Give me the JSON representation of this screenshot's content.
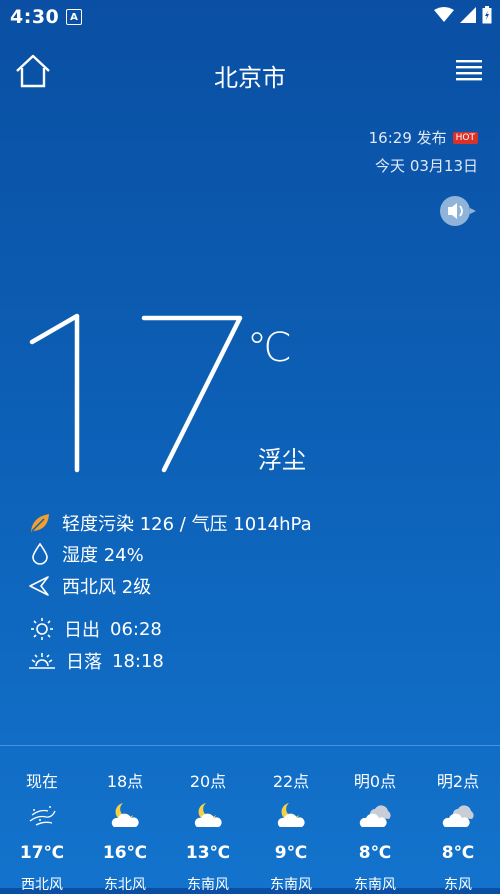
{
  "status_bar": {
    "time": "4:30",
    "a_badge": "A"
  },
  "header": {
    "city": "北京市"
  },
  "publish": {
    "time_text": "16:29 发布",
    "hot": "HOT",
    "date_text": "今天 03月13日"
  },
  "current": {
    "temperature": "17",
    "unit": "℃",
    "condition": "浮尘",
    "pollution": "轻度污染 126 / 气压 1014hPa",
    "humidity": "湿度 24%",
    "wind": "西北风 2级",
    "sunrise_label": "日出",
    "sunrise_time": "06:28",
    "sunset_label": "日落",
    "sunset_time": "18:18"
  },
  "forecast": [
    {
      "time": "现在",
      "temp": "17℃",
      "wind": "西北风",
      "icon": "dust-icon"
    },
    {
      "time": "18点",
      "temp": "16℃",
      "wind": "东北风",
      "icon": "moon-cloud-icon"
    },
    {
      "time": "20点",
      "temp": "13℃",
      "wind": "东南风",
      "icon": "moon-cloud-icon"
    },
    {
      "time": "22点",
      "temp": "9℃",
      "wind": "东南风",
      "icon": "moon-cloud-icon"
    },
    {
      "time": "明0点",
      "temp": "8℃",
      "wind": "东南风",
      "icon": "cloudy-icon"
    },
    {
      "time": "明2点",
      "temp": "8℃",
      "wind": "东风",
      "icon": "cloudy-icon"
    }
  ]
}
